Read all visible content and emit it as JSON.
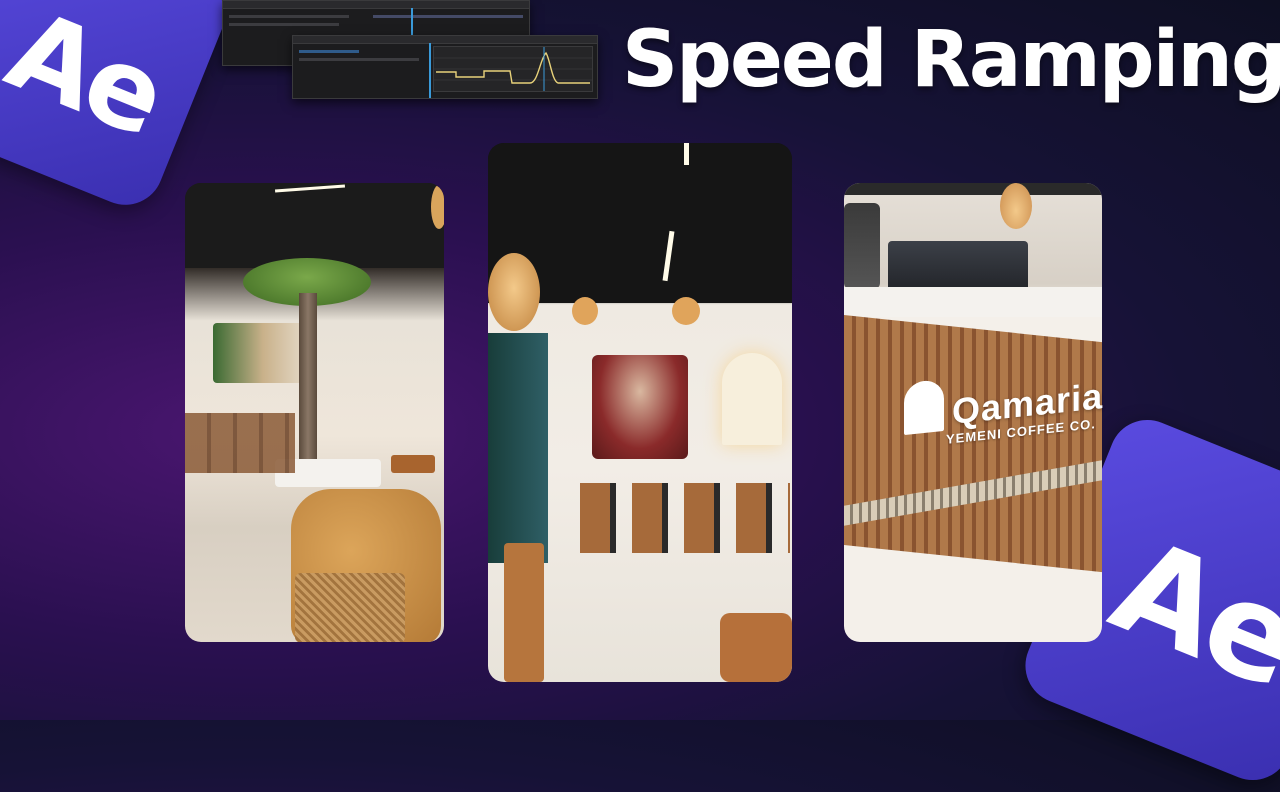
{
  "title": "Speed Ramping",
  "badges": {
    "app_logo_text": "Ae",
    "color": "#4a3fd0"
  },
  "photos": [
    {
      "name": "cafe-interior-tree"
    },
    {
      "name": "cafe-interior-mural"
    },
    {
      "name": "cafe-counter-sign"
    }
  ],
  "sign": {
    "brand": "Qamaria",
    "tagline": "YEMENI COFFEE CO."
  },
  "colors": {
    "accent": "#4a3fd0",
    "graph_curve": "#e8d27a",
    "timeline_cyan": "#3a9ad9"
  }
}
